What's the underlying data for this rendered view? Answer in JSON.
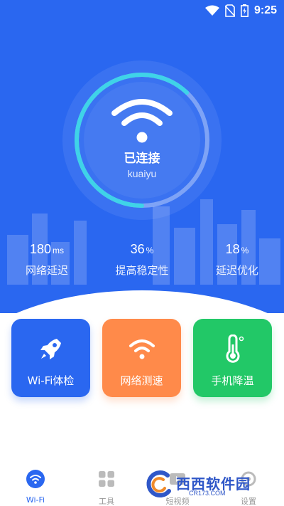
{
  "status_bar": {
    "time": "9:25"
  },
  "connection": {
    "status": "已连接",
    "ssid": "kuaiyu",
    "progress_fraction": 0.62
  },
  "stats": [
    {
      "value": "180",
      "unit": "ms",
      "label": "网络延迟"
    },
    {
      "value": "36",
      "unit": "%",
      "label": "提高稳定性"
    },
    {
      "value": "18",
      "unit": "%",
      "label": "延迟优化"
    }
  ],
  "tools": [
    {
      "label": "Wi-Fi体检",
      "icon": "rocket-icon",
      "color": "#2a67f0"
    },
    {
      "label": "网络测速",
      "icon": "wifi-icon",
      "color": "#ff8a4a"
    },
    {
      "label": "手机降温",
      "icon": "thermometer-icon",
      "color": "#22c867"
    }
  ],
  "nav": [
    {
      "label": "Wi-Fi",
      "icon": "wifi-icon",
      "active": true
    },
    {
      "label": "工具",
      "icon": "grid-icon",
      "active": false
    },
    {
      "label": "短视频",
      "icon": "video-icon",
      "active": false
    },
    {
      "label": "设置",
      "icon": "settings-icon",
      "active": false
    }
  ],
  "watermark": {
    "name": "西西软件园",
    "url": "CR173.COM"
  },
  "colors": {
    "primary": "#2a67f0",
    "orange": "#ff8a4a",
    "green": "#22c867",
    "gauge_accent": "#3fd3e8"
  }
}
